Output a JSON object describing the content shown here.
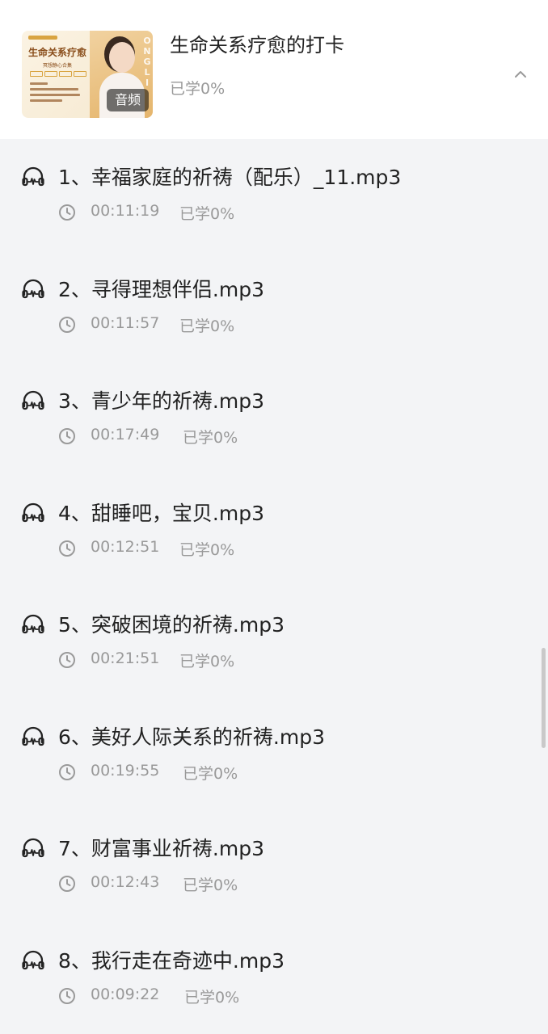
{
  "header": {
    "course_title": "生命关系疗愈的打卡",
    "course_progress": "已学0%",
    "cover": {
      "title": "生命关系疗愈",
      "subtitle": "冥想静心合集",
      "badge": "音频",
      "side_letters": "ONGLI"
    }
  },
  "list": {
    "items": [
      {
        "title": "1、幸福家庭的祈祷（配乐）_11.mp3",
        "duration": "00:11:19",
        "progress": "已学0%"
      },
      {
        "title": "2、寻得理想伴侣.mp3",
        "duration": "00:11:57",
        "progress": "已学0%"
      },
      {
        "title": "3、青少年的祈祷.mp3",
        "duration": "00:17:49",
        "progress": "已学0%"
      },
      {
        "title": "4、甜睡吧，宝贝.mp3",
        "duration": "00:12:51",
        "progress": "已学0%"
      },
      {
        "title": "5、突破困境的祈祷.mp3",
        "duration": "00:21:51",
        "progress": "已学0%"
      },
      {
        "title": "6、美好人际关系的祈祷.mp3",
        "duration": "00:19:55",
        "progress": "已学0%"
      },
      {
        "title": "7、财富事业祈祷.mp3",
        "duration": "00:12:43",
        "progress": "已学0%"
      },
      {
        "title": "8、我行走在奇迹中.mp3",
        "duration": "00:09:22",
        "progress": "已学0%"
      }
    ]
  },
  "icons": {
    "item_icon": "headphones-icon",
    "duration_icon": "clock-icon",
    "collapse_icon": "chevron-up-icon"
  },
  "colors": {
    "background": "#f3f4f6",
    "header_background": "#ffffff",
    "primary_text": "#222222",
    "secondary_text": "#999999"
  }
}
